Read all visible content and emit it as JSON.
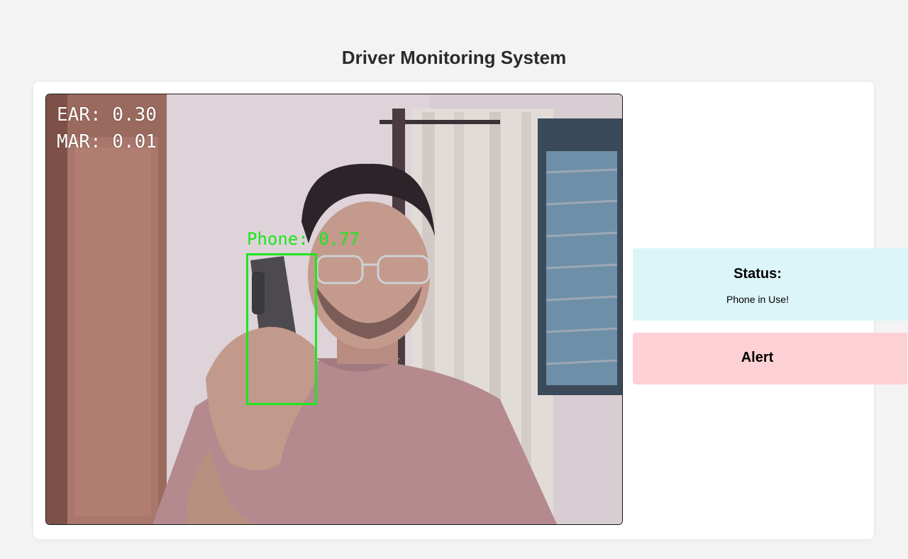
{
  "header": {
    "title": "Driver Monitoring System"
  },
  "video_feed": {
    "ear_text": "EAR: 0.30",
    "mar_text": "MAR: 0.01",
    "detection_label": "Phone: 0.77",
    "detection_color": "#1ee61e"
  },
  "status_panel": {
    "title": "Status:",
    "message": "Phone in Use!",
    "background": "#dcf5f8"
  },
  "alert_panel": {
    "title": "Alert",
    "background": "#fdd0d5"
  }
}
